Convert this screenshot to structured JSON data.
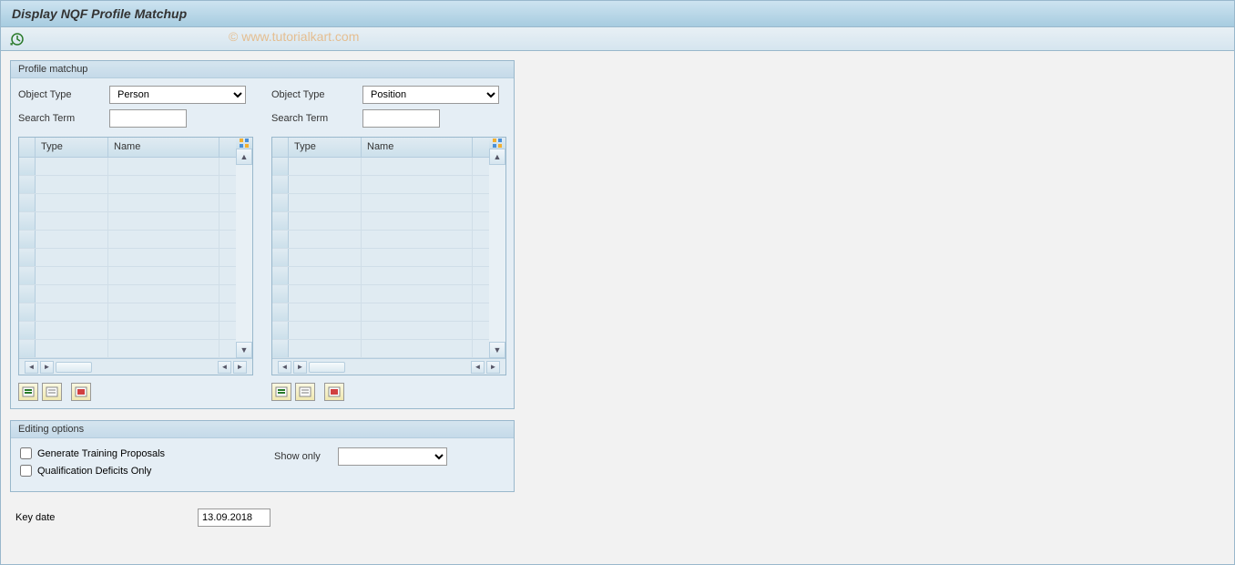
{
  "title": "Display NQF Profile Matchup",
  "watermark": "© www.tutorialkart.com",
  "profile_matchup": {
    "header": "Profile matchup",
    "left": {
      "object_type_label": "Object Type",
      "object_type_value": "Person",
      "search_term_label": "Search Term",
      "search_term_value": "",
      "table": {
        "col_type": "Type",
        "col_name": "Name"
      }
    },
    "right": {
      "object_type_label": "Object Type",
      "object_type_value": "Position",
      "search_term_label": "Search Term",
      "search_term_value": "",
      "table": {
        "col_type": "Type",
        "col_name": "Name"
      }
    }
  },
  "editing_options": {
    "header": "Editing options",
    "cb1": "Generate Training Proposals",
    "cb2": "Qualification Deficits Only",
    "show_only_label": "Show only",
    "show_only_value": ""
  },
  "keydate": {
    "label": "Key date",
    "value": "13.09.2018"
  }
}
